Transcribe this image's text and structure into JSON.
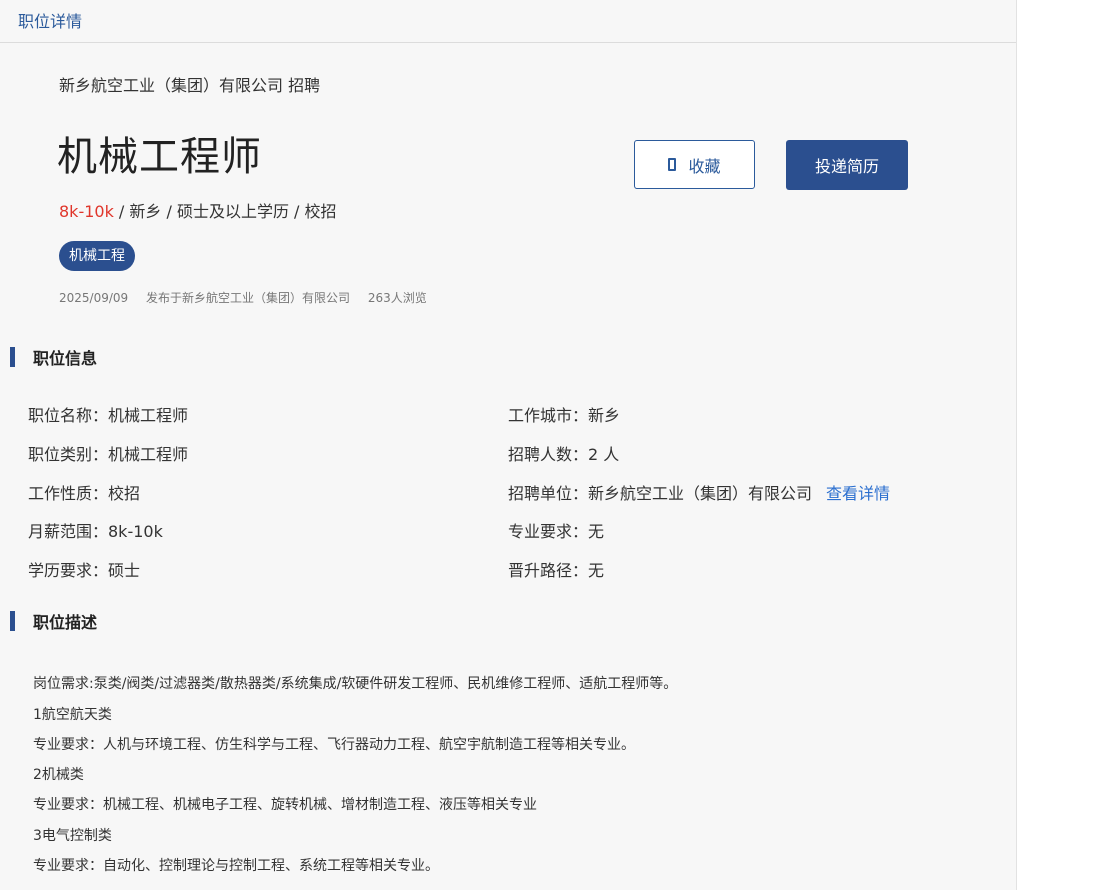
{
  "topbar": {
    "title": "职位详情"
  },
  "header": {
    "company_line": "新乡航空工业（集团）有限公司 招聘",
    "job_title": "机械工程师",
    "salary": "8k-10k",
    "meta_rest": " / 新乡 / 硕士及以上学历 / 校招",
    "tag": "机械工程",
    "date": "2025/09/09",
    "publisher": "发布于新乡航空工业（集团）有限公司",
    "views": "263人浏览"
  },
  "actions": {
    "favorite_label": "收藏",
    "apply_label": "投递简历"
  },
  "info_section": {
    "title": "职位信息",
    "left": [
      "职位名称：机械工程师",
      "职位类别：机械工程师",
      "工作性质：校招",
      "月薪范围：8k-10k",
      "学历要求：硕士"
    ],
    "right": [
      "工作城市：新乡",
      "招聘人数：2 人",
      "招聘单位：新乡航空工业（集团）有限公司",
      "专业要求：无",
      "晋升路径：无"
    ],
    "detail_link": "查看详情"
  },
  "desc_section": {
    "title": "职位描述",
    "lines": [
      "岗位需求:泵类/阀类/过滤器类/散热器类/系统集成/软硬件研发工程师、民机维修工程师、适航工程师等。",
      "1航空航天类",
      "专业要求：人机与环境工程、仿生科学与工程、飞行器动力工程、航空宇航制造工程等相关专业。",
      "2机械类",
      "专业要求：机械工程、机械电子工程、旋转机械、增材制造工程、液压等相关专业",
      "3电气控制类",
      "专业要求：自动化、控制理论与控制工程、系统工程等相关专业。"
    ]
  }
}
